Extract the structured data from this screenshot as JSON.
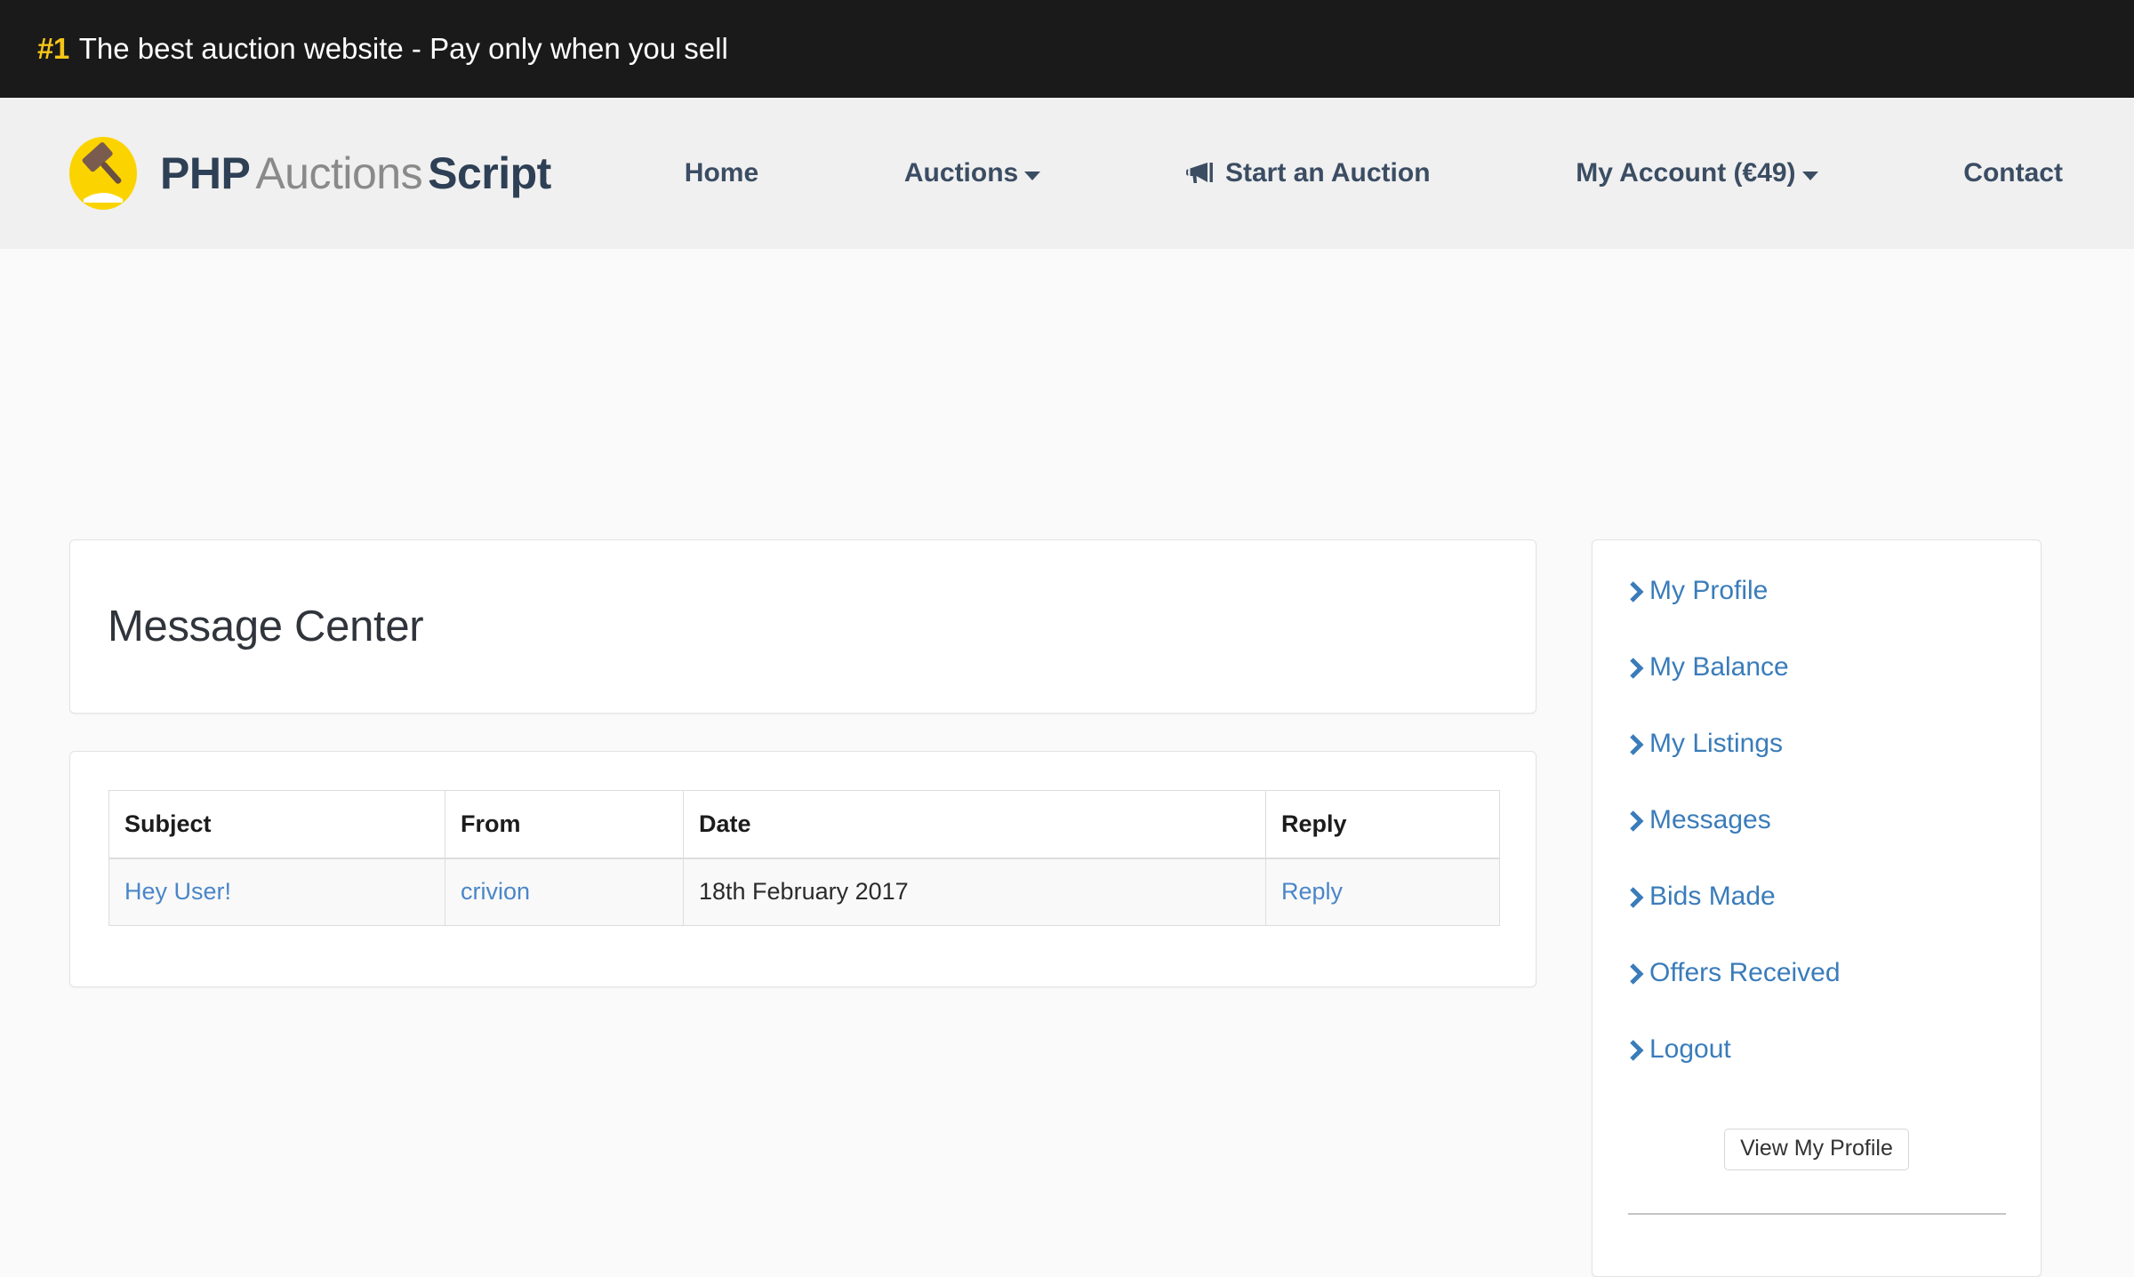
{
  "topbar": {
    "rank": "#1",
    "tagline": "The best auction website - Pay only when you sell"
  },
  "brand": {
    "part1": "PHP",
    "part2": "Auctions",
    "part3": "Script",
    "logo_icon": "gavel-icon",
    "logo_color": "#fbd400"
  },
  "nav": {
    "items": [
      {
        "label": "Home",
        "icon": null,
        "caret": false
      },
      {
        "label": "Auctions",
        "icon": null,
        "caret": true
      },
      {
        "label": "Start an Auction",
        "icon": "bullhorn-icon",
        "caret": false
      },
      {
        "label": "My Account (€49)",
        "icon": null,
        "caret": true
      },
      {
        "label": "Contact",
        "icon": null,
        "caret": false
      }
    ]
  },
  "main": {
    "page_title": "Message Center",
    "table": {
      "columns": [
        "Subject",
        "From",
        "Date",
        "Reply"
      ],
      "rows": [
        {
          "subject": "Hey User!",
          "from": "crivion",
          "date": "18th February 2017",
          "reply": "Reply"
        }
      ]
    }
  },
  "sidebar": {
    "links": [
      {
        "label": "My Profile",
        "icon": "chevron-right-icon"
      },
      {
        "label": "My Balance",
        "icon": "chevron-right-icon"
      },
      {
        "label": "My Listings",
        "icon": "chevron-right-icon"
      },
      {
        "label": "Messages",
        "icon": "chevron-right-icon"
      },
      {
        "label": "Bids Made",
        "icon": "chevron-right-icon"
      },
      {
        "label": "Offers Received",
        "icon": "chevron-right-icon"
      },
      {
        "label": "Logout",
        "icon": "chevron-right-icon"
      }
    ],
    "button_label": "View My Profile",
    "link_color": "#3a7cba"
  }
}
